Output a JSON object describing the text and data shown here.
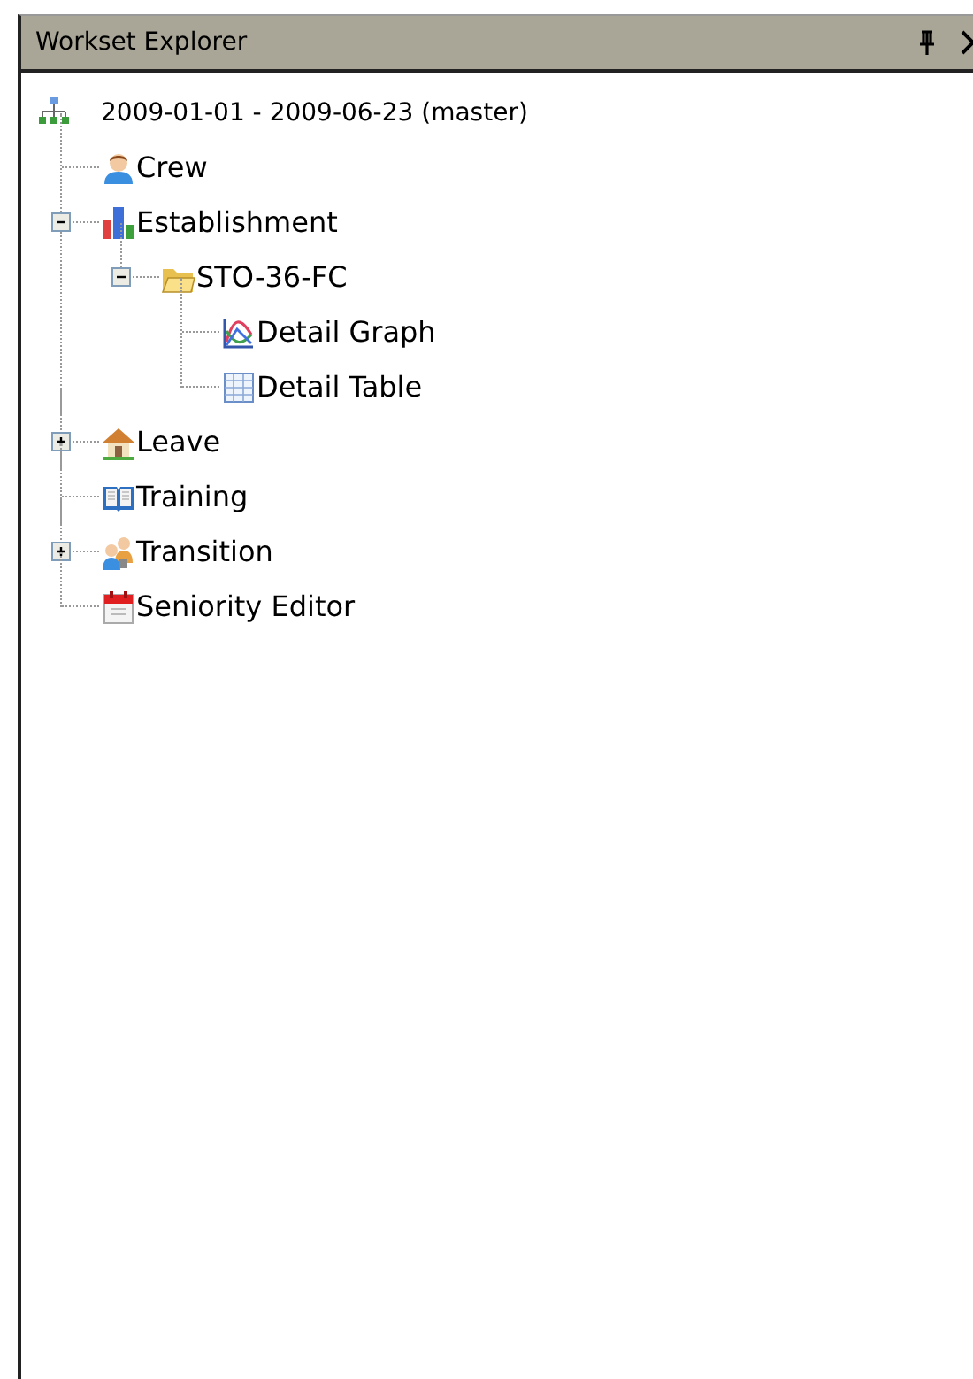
{
  "panel": {
    "title": "Workset Explorer"
  },
  "tree": {
    "label": "2009-01-01 - 2009-06-23 (master)",
    "kind": "hierarchy",
    "children": [
      {
        "label": "Crew",
        "kind": "person"
      },
      {
        "label": "Establishment",
        "kind": "bars",
        "expanded": true,
        "children": [
          {
            "label": "STO-36-FC",
            "kind": "folder",
            "expanded": true,
            "children": [
              {
                "label": "Detail Graph",
                "kind": "graph"
              },
              {
                "label": "Detail Table",
                "kind": "table"
              }
            ]
          }
        ]
      },
      {
        "label": "Leave",
        "kind": "house",
        "expanded": false
      },
      {
        "label": "Training",
        "kind": "book"
      },
      {
        "label": "Transition",
        "kind": "people",
        "expanded": false
      },
      {
        "label": "Seniority Editor",
        "kind": "calendar"
      }
    ]
  }
}
